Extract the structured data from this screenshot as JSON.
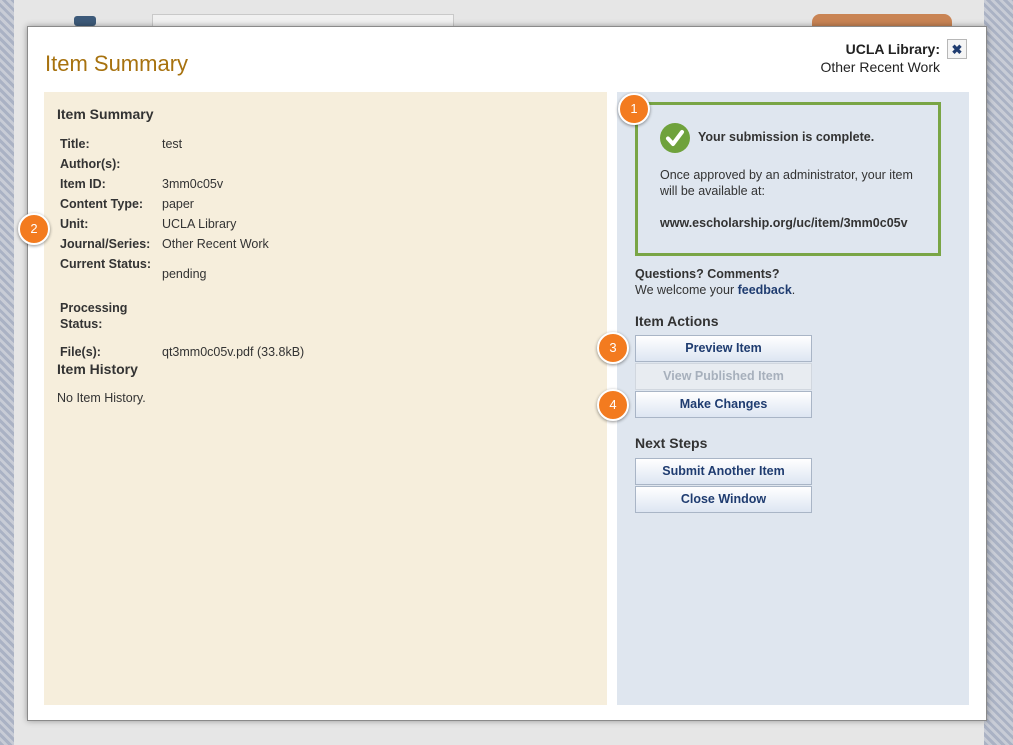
{
  "modal": {
    "title": "Item Summary",
    "unit_name": "UCLA Library:",
    "unit_sub": "Other Recent Work",
    "close_glyph": "✖"
  },
  "summary": {
    "heading": "Item Summary",
    "rows": [
      {
        "label": "Title:",
        "value": "test"
      },
      {
        "label": "Author(s):",
        "value": ""
      },
      {
        "label": "Item ID:",
        "value": "3mm0c05v"
      },
      {
        "label": "Content Type:",
        "value": "paper"
      },
      {
        "label": "Unit:",
        "value": "UCLA Library"
      },
      {
        "label": "Journal/Series:",
        "value": "Other Recent Work"
      },
      {
        "label": "Current Status:",
        "value": "pending"
      },
      {
        "label": "Processing Status:",
        "value": ""
      },
      {
        "label": "File(s):",
        "value": "qt3mm0c05v.pdf (33.8kB)"
      }
    ]
  },
  "history": {
    "heading": "Item History",
    "empty_text": "No Item History."
  },
  "submission": {
    "title": "Your submission is complete.",
    "text": "Once approved by an administrator, your item will be available at:",
    "url": "www.escholarship.org/uc/item/3mm0c05v"
  },
  "questions": {
    "heading": "Questions? Comments?",
    "prefix": "We welcome your",
    "link": "feedback",
    "suffix": "."
  },
  "item_actions": {
    "heading": "Item Actions",
    "preview": "Preview Item",
    "view_published": "View Published Item",
    "make_changes": "Make Changes"
  },
  "next_steps": {
    "heading": "Next Steps",
    "submit_another": "Submit Another Item",
    "close_window": "Close Window"
  },
  "callouts": [
    "1",
    "2",
    "3",
    "4"
  ],
  "colors": {
    "title": "#a7720f",
    "success_border": "#79a545",
    "callout": "#f37b1f",
    "link": "#1f3c70",
    "left_panel": "#f6eedc",
    "right_panel": "#dfe6ef"
  },
  "icons": {
    "check": "check-circle-icon",
    "close": "close-icon"
  }
}
